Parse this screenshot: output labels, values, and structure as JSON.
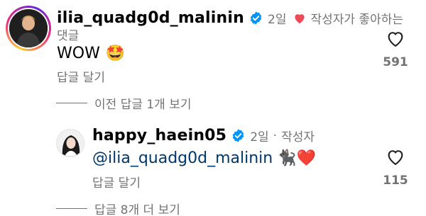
{
  "comment": {
    "username": "ilia_quadg0d_malinin",
    "time": "2일",
    "creator_liked_label": "작성자가 좋아하는",
    "creator_liked_label_cont": "댓글",
    "text": "WOW",
    "emoji": "🤩",
    "like_count": "591",
    "reply_label": "답글 달기",
    "view_previous_replies": "이전 답글 1개 보기"
  },
  "reply": {
    "username": "happy_haein05",
    "time": "2일",
    "author_label": "작성자",
    "mention": "@ilia_quadg0d_malinin",
    "emojis": "🐈‍⬛❤️",
    "like_count": "115",
    "reply_label": "답글 달기"
  },
  "more_replies": "답글 8개 더 보기",
  "colors": {
    "verified": "#0095f6",
    "liked_heart": "#ed4956",
    "secondary_text": "#737373",
    "mention": "#00376b"
  },
  "icons": [
    "verified-badge-icon",
    "heart-icon",
    "like-heart-outline-icon"
  ]
}
